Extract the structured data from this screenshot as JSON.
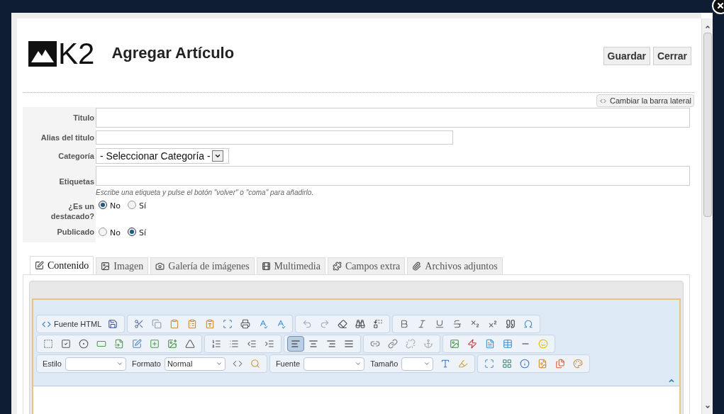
{
  "window": {
    "title": "Agregar Artículo",
    "logo": "K2"
  },
  "buttons": [
    "Guardar",
    "Cerrar"
  ],
  "sidebar_toggle": "Cambiar la barra lateral",
  "fields": [
    {
      "kind": "text",
      "label": "Titulo"
    },
    {
      "kind": "short",
      "label": "Alias del titulo"
    },
    {
      "kind": "select",
      "label": "Categoría",
      "value": "- Seleccionar Categoría -"
    },
    {
      "kind": "tags",
      "label": "Etiquetas",
      "hint": "Escribe una etiqueta y pulse el botón \"volver\" o \"coma\" para añadirlo."
    },
    {
      "kind": "radio",
      "label": "¿Es un destacado?",
      "options": [
        {
          "label": "No",
          "selected": true
        },
        {
          "label": "Sí",
          "selected": false
        }
      ]
    },
    {
      "kind": "radio",
      "label": "Publicado",
      "options": [
        {
          "label": "No",
          "selected": false
        },
        {
          "label": "Sí",
          "selected": true
        }
      ]
    }
  ],
  "tabs": [
    {
      "label": "Contenido",
      "selected": true
    },
    {
      "label": "Imagen",
      "selected": false
    },
    {
      "label": "Galería de imágenes",
      "selected": false
    },
    {
      "label": "Multimedia",
      "selected": false
    },
    {
      "label": "Campos extra",
      "selected": false
    },
    {
      "label": "Archivos adjuntos",
      "selected": false
    }
  ],
  "editor": {
    "source_button": "Fuente HTML",
    "alignment": [
      {
        "selected": true
      },
      {
        "selected": false
      },
      {
        "selected": false
      },
      {
        "selected": false
      }
    ],
    "dropdowns": [
      {
        "label": "Estilo"
      },
      {
        "label": "Formato",
        "value": "Normal"
      },
      {
        "label": "Fuente"
      },
      {
        "label": "Tamaño"
      }
    ]
  }
}
